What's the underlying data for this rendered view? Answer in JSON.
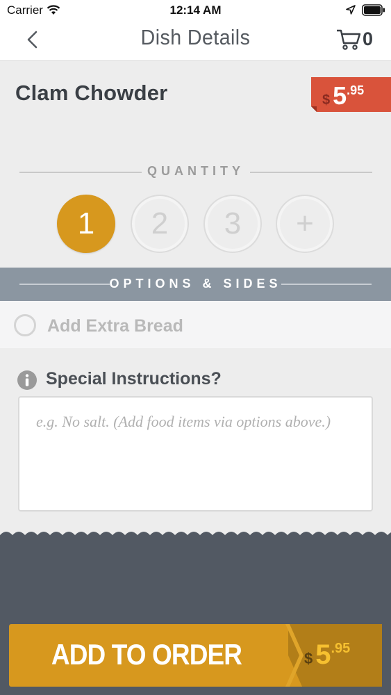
{
  "status_bar": {
    "carrier": "Carrier",
    "time": "12:14 AM"
  },
  "nav": {
    "title": "Dish Details",
    "cart_count": "0",
    "icons": {
      "back": "chevron-left-icon",
      "cart": "cart-icon"
    }
  },
  "dish": {
    "name": "Clam Chowder",
    "price_symbol": "$",
    "price_int": "5",
    "price_dec": ".95"
  },
  "quantity": {
    "label": "QUANTITY",
    "options": [
      "1",
      "2",
      "3",
      "+"
    ],
    "selected": "1"
  },
  "options": {
    "label": "OPTIONS & SIDES",
    "items": [
      {
        "label": "Add Extra Bread",
        "checked": false
      }
    ]
  },
  "instructions": {
    "label": "Special Instructions?",
    "placeholder": "e.g. No salt. (Add food items via options above.)",
    "value": ""
  },
  "add_to_order": {
    "label": "ADD TO ORDER",
    "price_symbol": "$",
    "price_int": "5",
    "price_dec": ".95"
  },
  "colors": {
    "accent": "#d7981e",
    "price_tag": "#d9533b",
    "options_band": "#8b96a1",
    "bottom_panel": "#525963"
  }
}
